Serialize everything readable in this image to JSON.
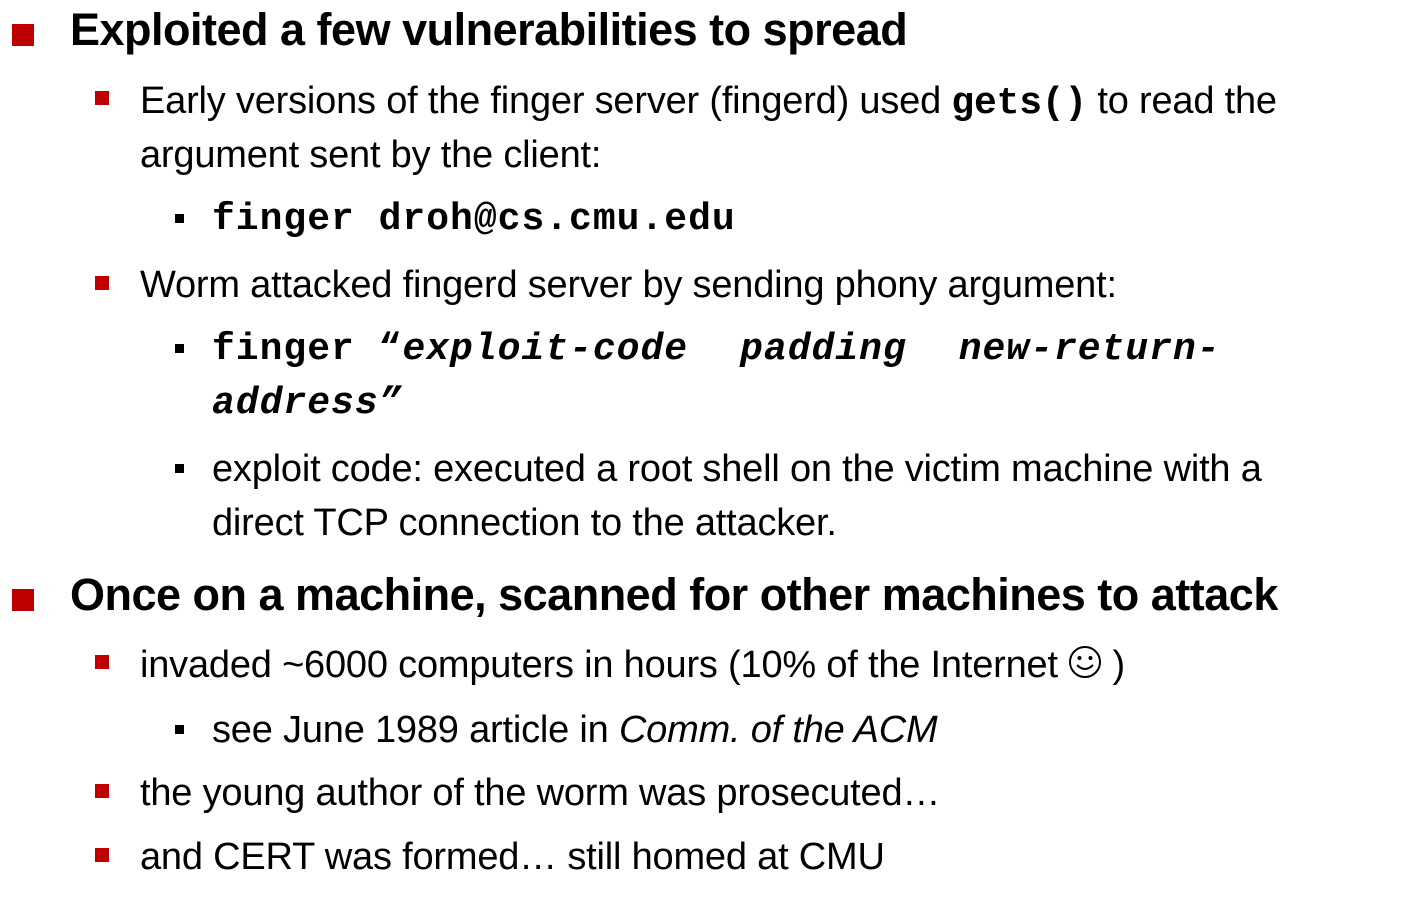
{
  "items": [
    {
      "text": "Exploited a few vulnerabilities to spread",
      "children": [
        {
          "text_before": "Early versions of the finger server (fingerd) used ",
          "code": "gets()",
          "text_after": " to read the",
          "text_line2": "argument sent by the client:",
          "children": [
            {
              "code": "finger droh@cs.cmu.edu"
            }
          ]
        },
        {
          "text": "Worm attacked fingerd server by sending phony argument:",
          "children": [
            {
              "code_prefix": "finger “",
              "code_w1": "exploit-code",
              "code_w2": "padding",
              "code_w3": "new-return-",
              "code_line2": "address”"
            },
            {
              "text": "exploit code: executed a root shell on the victim machine with a",
              "text_line2": "direct TCP connection to the attacker."
            }
          ]
        }
      ]
    },
    {
      "text": "Once on a machine, scanned for other machines to attack",
      "children": [
        {
          "text_before": "invaded ~6000 computers in hours (10% of the Internet ",
          "text_after": " )",
          "icon": "smiley-face-icon",
          "children": [
            {
              "text_before": "see June 1989 article in ",
              "italic": "Comm. of the ACM"
            }
          ]
        },
        {
          "text": "the young author of the worm was prosecuted…"
        },
        {
          "text": "and CERT was formed… still homed at CMU"
        }
      ]
    }
  ],
  "colors": {
    "bullet_level1": "#c00000",
    "bullet_level2": "#c00000",
    "bullet_level3": "#000000",
    "text": "#000000",
    "background": "#ffffff"
  }
}
